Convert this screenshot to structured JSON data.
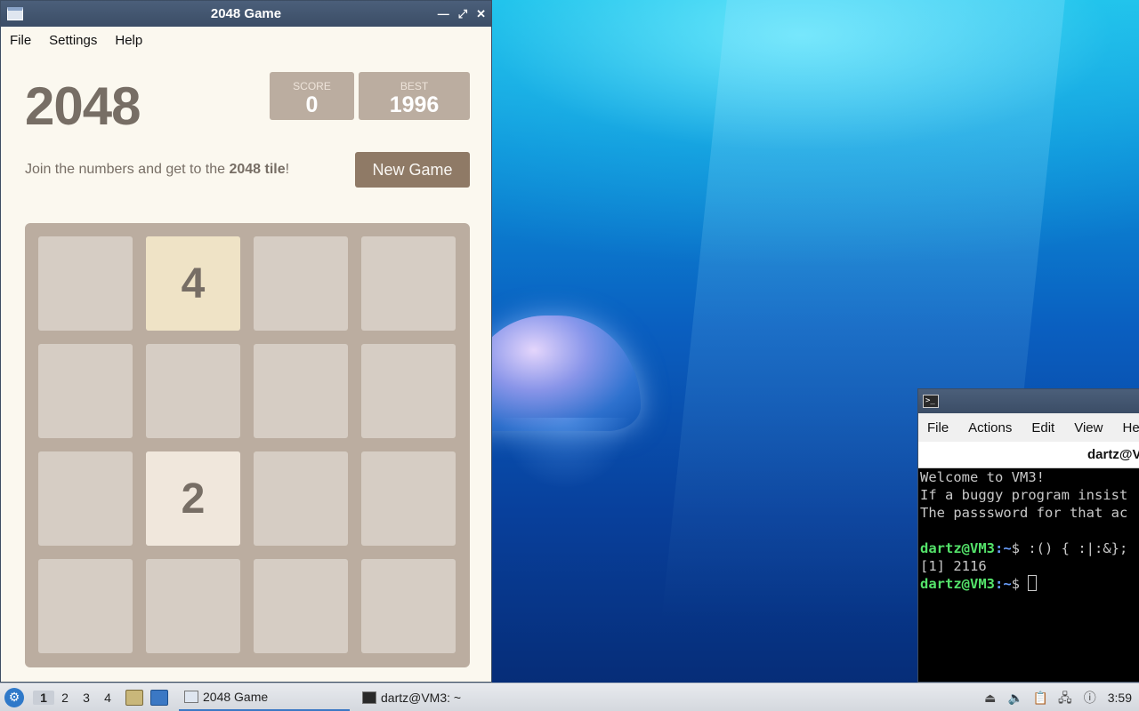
{
  "game_window": {
    "title": "2048 Game",
    "menu": [
      "File",
      "Settings",
      "Help"
    ],
    "heading": "2048",
    "score_label": "SCORE",
    "score_value": "0",
    "best_label": "BEST",
    "best_value": "1996",
    "intro_prefix": "Join the numbers and get to the ",
    "intro_bold": "2048 tile",
    "intro_suffix": "!",
    "new_game_label": "New Game",
    "board": [
      [
        "",
        "4",
        "",
        ""
      ],
      [
        "",
        "",
        "",
        ""
      ],
      [
        "",
        "2",
        "",
        ""
      ],
      [
        "",
        "",
        "",
        ""
      ]
    ],
    "colors": {
      "background": "#fbf8ef",
      "board": "#bbada0",
      "empty_cell": "#d6cdc4",
      "tile_2": "#f0e7dc",
      "tile_4": "#efe3c6",
      "button": "#8f7a66",
      "text": "#776e65"
    }
  },
  "terminal_window": {
    "menu": [
      "File",
      "Actions",
      "Edit",
      "View",
      "Hel"
    ],
    "tab_title": "dartz@V",
    "lines": [
      "Welcome to VM3!",
      "If a buggy program insist",
      "The passsword for that ac",
      ""
    ],
    "prompt1_user": "dartz@VM3",
    "prompt1_path": ":~",
    "prompt1_cmd": "$ :() { :|:&};",
    "job_line": "[1] 2116",
    "prompt2_user": "dartz@VM3",
    "prompt2_path": ":~",
    "prompt2_cmd": "$ "
  },
  "taskbar": {
    "workspaces": [
      "1",
      "2",
      "3",
      "4"
    ],
    "active_workspace": "1",
    "tasks": [
      {
        "label": "2048 Game",
        "icon": "window-icon",
        "active": true
      },
      {
        "label": "dartz@VM3: ~",
        "icon": "terminal-icon",
        "active": false
      }
    ],
    "clock": "3:59"
  }
}
